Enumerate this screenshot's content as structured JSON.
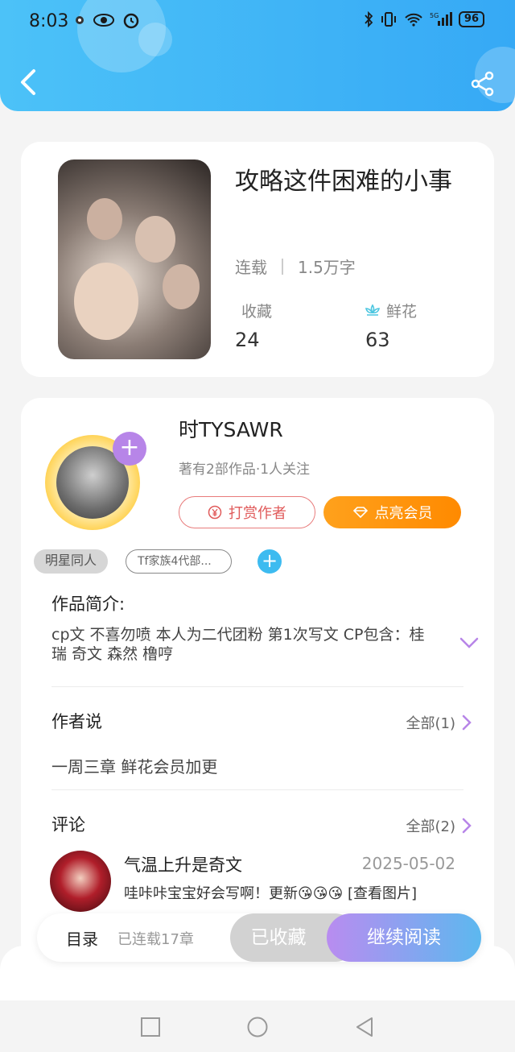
{
  "status_bar": {
    "time": "8:03",
    "battery": "96",
    "network": "5G"
  },
  "book": {
    "title": "攻略这件困难的小事",
    "status": "连载",
    "word_count": "1.5万字",
    "favorites_label": "收藏",
    "favorites_value": "24",
    "flowers_label": "鲜花",
    "flowers_value": "63"
  },
  "author": {
    "name": "时TYSAWR",
    "subtitle": "著有2部作品·1人关注",
    "tip_button": "打赏作者",
    "vip_button": "点亮会员",
    "avatar_plus": "+"
  },
  "tags": [
    "明星同人",
    "Tf家族4代部..."
  ],
  "tag_add": "+",
  "intro": {
    "heading": "作品简介:",
    "text": "cp文  不喜勿喷  本人为二代团粉  第1次写文  CP包含：桂瑞  奇文  森然  橹哼"
  },
  "author_says": {
    "heading": "作者说",
    "all_link": "全部(1)",
    "text": "一周三章  鲜花会员加更"
  },
  "comments": {
    "heading": "评论",
    "all_link": "全部(2)",
    "items": [
      {
        "name": "气温上升是奇文",
        "date": "2025-05-02",
        "text": "哇咔咔宝宝好会写啊！更新😘😘😘 [查看图片]"
      }
    ]
  },
  "action_bar": {
    "menu_label": "目录",
    "chapter_count": "已连载17章",
    "favorited_label": "已收藏",
    "read_label": "继续阅读"
  },
  "colors": {
    "header": "#3fb6f6",
    "vip": "#ff9410",
    "tip": "#e05a5a",
    "accent_purple": "#b785e8",
    "accent_blue": "#3dbbf0"
  }
}
